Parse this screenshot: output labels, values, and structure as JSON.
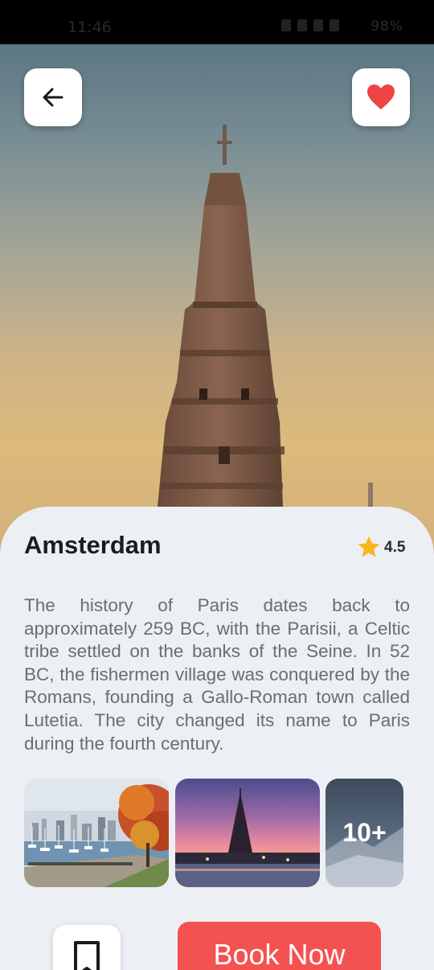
{
  "status_bar": {
    "time": "11:46",
    "battery": "98%"
  },
  "place": {
    "name": "Amsterdam",
    "rating": "4.5"
  },
  "description": "The history of Paris dates back to approximately 259 BC, with the Parisii, a Celtic tribe settled on the banks of the Seine. In 52 BC, the fishermen village was conquered by the Romans, founding a Gallo-Roman town called Lutetia. The city changed its name to Paris during the fourth century.",
  "gallery": {
    "more_label": "10+"
  },
  "actions": {
    "book_label": "Book Now"
  },
  "colors": {
    "accent": "#f45250",
    "favorite": "#ef4444",
    "star": "#f5b81c",
    "sheet": "#ecf0f4"
  },
  "icons": [
    "back-arrow-icon",
    "heart-icon",
    "star-icon",
    "bookmark-icon"
  ]
}
